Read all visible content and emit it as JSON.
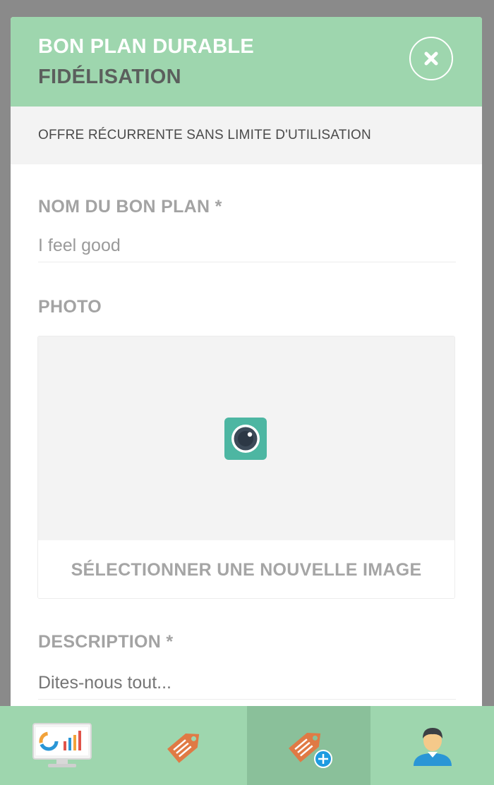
{
  "header": {
    "title": "BON PLAN DURABLE",
    "subtitle": "FIDÉLISATION"
  },
  "offer_type": "OFFRE RÉCURRENTE SANS LIMITE D'UTILISATION",
  "form": {
    "name_label": "NOM DU BON PLAN *",
    "name_value": "I feel good",
    "photo_label": "PHOTO",
    "select_image_label": "SÉLECTIONNER UNE NOUVELLE IMAGE",
    "description_label": "DESCRIPTION *",
    "description_placeholder": "Dites-nous tout..."
  },
  "tabbar": {
    "tabs": [
      {
        "icon": "dashboard-monitor-icon",
        "active": false
      },
      {
        "icon": "price-tag-icon",
        "active": false
      },
      {
        "icon": "add-tag-icon",
        "active": true
      },
      {
        "icon": "user-profile-icon",
        "active": false
      }
    ]
  },
  "colors": {
    "accent": "#9ed6ae",
    "accent_active": "#8ac09a",
    "tag_orange": "#e07a45",
    "camera_teal": "#4db6a2",
    "plus_blue": "#1e9be0",
    "overlay": "#8a8a8a"
  }
}
